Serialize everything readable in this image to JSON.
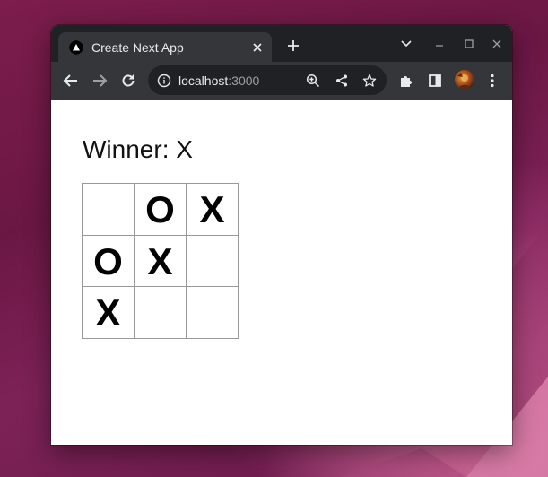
{
  "browser": {
    "tab": {
      "title": "Create Next App",
      "favicon": "nextjs-triangle-icon"
    },
    "address_bar": {
      "host": "localhost",
      "port": ":3000"
    },
    "colors": {
      "tabstrip": "#202124",
      "toolbar": "#35363a",
      "text": "#e8eaed"
    }
  },
  "game": {
    "status": "Winner: X",
    "squares": [
      "",
      "O",
      "X",
      "O",
      "X",
      "",
      "X",
      "",
      ""
    ]
  },
  "desktop": {
    "colors": {
      "background": "#6b1744",
      "highlight": "#d9759f"
    }
  }
}
